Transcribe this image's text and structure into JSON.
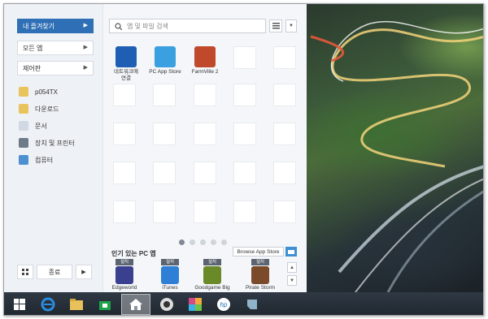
{
  "left_panel": {
    "favorites_label": "내 즐겨찾기",
    "all_apps_label": "모든 앱",
    "control_panel_label": "제어판",
    "places": [
      {
        "label": "p054TX",
        "icon": "user-folder-icon"
      },
      {
        "label": "다운로드",
        "icon": "downloads-folder-icon"
      },
      {
        "label": "문서",
        "icon": "documents-icon"
      },
      {
        "label": "장치 및 프린터",
        "icon": "devices-printers-icon"
      },
      {
        "label": "컴퓨터",
        "icon": "computer-icon"
      }
    ],
    "shutdown_label": "종료"
  },
  "search": {
    "placeholder": "앱 및 파일 검색"
  },
  "pinned_apps": [
    {
      "label": "네트워크에\n연결",
      "icon": "network-icon",
      "color": "#1e5fb4"
    },
    {
      "label": "PC App Store",
      "icon": "app-store-icon",
      "color": "#3aa0e0"
    },
    {
      "label": "FarmVille 2",
      "icon": "farmville-icon",
      "color": "#c0492b"
    }
  ],
  "pagination": {
    "pages": 5,
    "current": 1
  },
  "popular": {
    "title": "인기 있는 PC 앱",
    "browse_label": "Browse App Store",
    "install_badge": "설치",
    "apps": [
      {
        "label": "Edgeworld",
        "color": "#3b3f8f"
      },
      {
        "label": "iTunes",
        "color": "#2f7fd6"
      },
      {
        "label": "Goodgame Big",
        "color": "#6a8a2a"
      },
      {
        "label": "Pirate Storm",
        "color": "#7a4a2a"
      }
    ]
  },
  "taskbar": {
    "items": [
      {
        "name": "start-button",
        "color": "#ffffff"
      },
      {
        "name": "internet-explorer-icon",
        "color": "#2a8de0"
      },
      {
        "name": "file-explorer-icon",
        "color": "#e8c15a"
      },
      {
        "name": "store-icon",
        "color": "#1ea34a"
      },
      {
        "name": "home-icon",
        "color": "#ffffff"
      },
      {
        "name": "camera-app-icon",
        "color": "#444"
      },
      {
        "name": "media-app-icon",
        "color": "#d24a8a"
      },
      {
        "name": "hp-icon",
        "color": "#ffffff"
      },
      {
        "name": "notes-app-icon",
        "color": "#8fb3c9"
      }
    ]
  }
}
